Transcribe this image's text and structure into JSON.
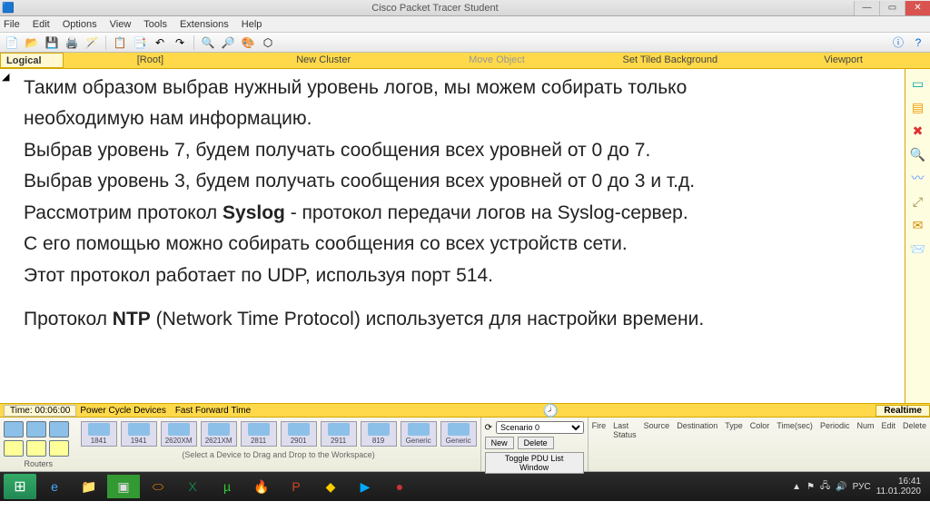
{
  "titlebar": {
    "title": "Cisco Packet Tracer Student"
  },
  "menu": [
    "File",
    "Edit",
    "Options",
    "View",
    "Tools",
    "Extensions",
    "Help"
  ],
  "yellownav": {
    "logical": "Logical",
    "root": "[Root]",
    "newcluster": "New Cluster",
    "moveobj": "Move Object",
    "settile": "Set Tiled Background",
    "viewport": "Viewport"
  },
  "doc": {
    "l1a": "Таким образом выбрав нужный уровень логов, мы можем собирать только",
    "l1b": "необходимую нам информацию.",
    "l2": "Выбрав уровень 7, будем получать сообщения всех уровней от 0 до 7.",
    "l3": "Выбрав уровень 3, будем получать сообщения всех уровней от 0 до 3 и т.д.",
    "l4a": "Рассмотрим протокол ",
    "l4b": "Syslog",
    "l4c": " - протокол передачи логов на Syslog-сервер.",
    "l5": "С его помощью можно собирать сообщения со всех устройств сети.",
    "l6": "Этот протокол работает по UDP, используя порт 514.",
    "l7a": "Протокол ",
    "l7b": "NTP",
    "l7c": " (Network Time Protocol) используется для настройки времени."
  },
  "rtbar": {
    "time": "Time: 00:06:00",
    "pcd": "Power Cycle Devices",
    "fft": "Fast Forward Time",
    "realtime": "Realtime"
  },
  "devpanel": {
    "category": "Routers",
    "models": [
      "1841",
      "1941",
      "2620XM",
      "2621XM",
      "2811",
      "2901",
      "2911",
      "819",
      "Generic",
      "Generic"
    ],
    "hint": "(Select a Device to Drag and Drop to the Workspace)",
    "scenario": {
      "label": "Scenario 0",
      "new": "New",
      "delete": "Delete",
      "toggle": "Toggle PDU List Window"
    },
    "pdu_headers": [
      "Fire",
      "Last Status",
      "Source",
      "Destination",
      "Type",
      "Color",
      "Time(sec)",
      "Periodic",
      "Num",
      "Edit",
      "Delete"
    ]
  },
  "taskbar": {
    "time": "16:41",
    "date": "11.01.2020",
    "lang": "РУС"
  }
}
